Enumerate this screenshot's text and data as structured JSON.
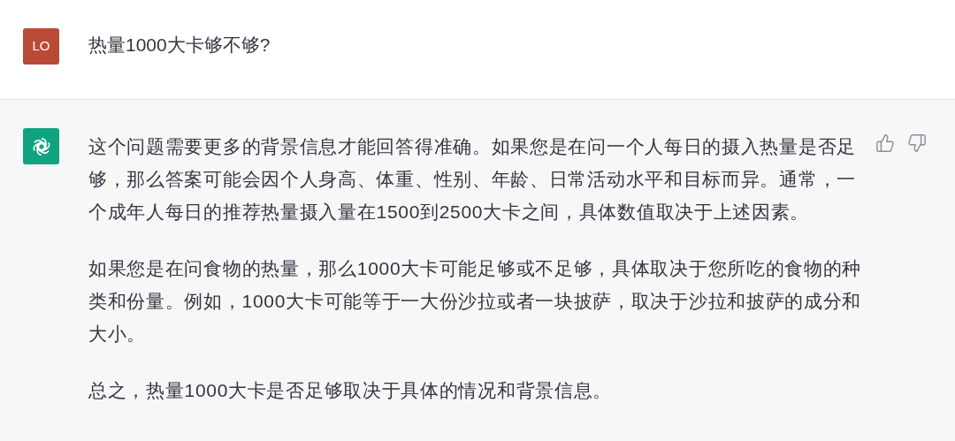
{
  "messages": [
    {
      "kind": "user",
      "avatar": "LO",
      "paragraphs": [
        "热量1000大卡够不够?"
      ]
    },
    {
      "kind": "assistant",
      "paragraphs": [
        "这个问题需要更多的背景信息才能回答得准确。如果您是在问一个人每日的摄入热量是否足够，那么答案可能会因个人身高、体重、性别、年龄、日常活动水平和目标而异。通常，一个成年人每日的推荐热量摄入量在1500到2500大卡之间，具体数值取决于上述因素。",
        "如果您是在问食物的热量，那么1000大卡可能足够或不足够，具体取决于您所吃的食物的种类和份量。例如，1000大卡可能等于一大份沙拉或者一块披萨，取决于沙拉和披萨的成分和大小。",
        "总之，热量1000大卡是否足够取决于具体的情况和背景信息。"
      ]
    }
  ]
}
